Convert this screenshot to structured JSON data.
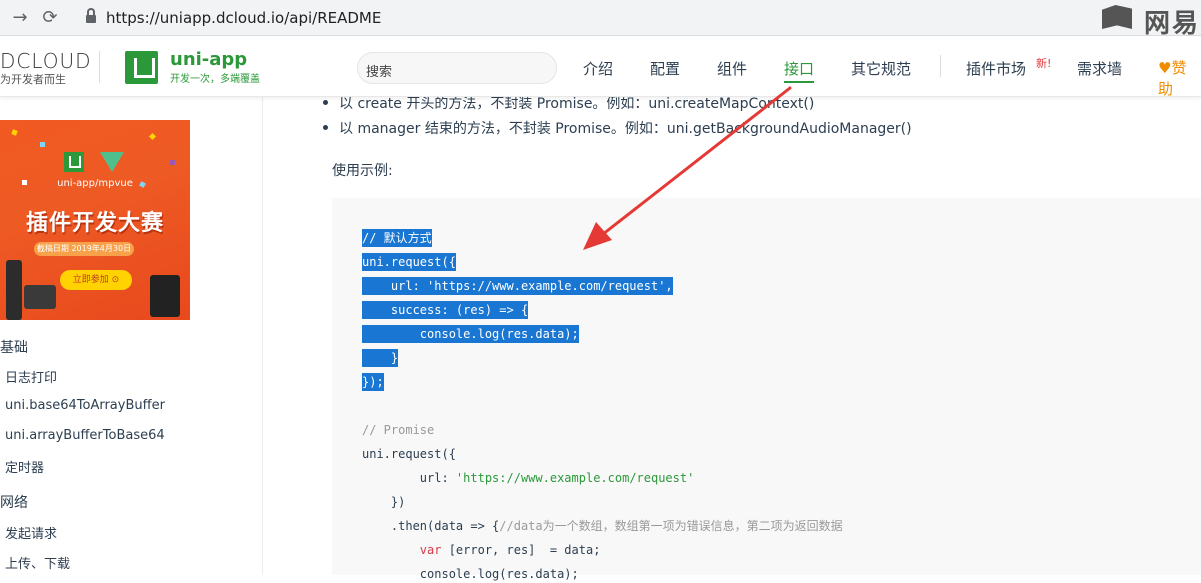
{
  "browser": {
    "url": "https://uniapp.dcloud.io/api/README",
    "watermark": "网易"
  },
  "header": {
    "dcloud_logo": "DCLOUD",
    "dcloud_slogan": "为开发者而生",
    "app_name": "uni-app",
    "app_tagline": "开发一次，多端覆盖",
    "search_placeholder": "搜索",
    "nav": [
      "介绍",
      "配置",
      "组件",
      "接口",
      "其它规范",
      "插件市场",
      "需求墙",
      "赞助"
    ],
    "active_nav": "接口",
    "new_badge": "新!"
  },
  "sidebar": {
    "banner": {
      "subtitle": "uni-app/mpvue",
      "title": "插件开发大赛",
      "deadline": "截稿日期 2019年4月30日",
      "button": "立即参加"
    },
    "groups": [
      {
        "label": "基础",
        "items": [
          "日志打印",
          "uni.base64ToArrayBuffer",
          "uni.arrayBufferToBase64",
          "定时器"
        ]
      },
      {
        "label": "网络",
        "items": [
          "发起请求",
          "上传、下载"
        ]
      }
    ]
  },
  "content": {
    "bullets": [
      "以 create 开头的方法，不封装 Promise。例如：uni.createMapContext()",
      "以 manager 结束的方法，不封装 Promise。例如：uni.getBackgroundAudioManager()"
    ],
    "usage_label": "使用示例:",
    "code": {
      "l1": "// 默认方式",
      "l2": "uni.request({",
      "l3": "    url: 'https://www.example.com/request',",
      "l4": "    success: (res) => {",
      "l5": "        console.log(res.data);",
      "l6": "    }",
      "l7": "});",
      "l8": "// Promise",
      "l9": "uni.request({",
      "l10a": "        url: ",
      "l10b": "'https://www.example.com/request'",
      "l11": "    })",
      "l12a": "    .then(data => {",
      "l12b": "//data为一个数组，数组第一项为错误信息，第二项为返回数据",
      "l13a": "var",
      "l13b": " [error, res]  = data;",
      "l14": "        console.log(res.data);"
    }
  },
  "colors": {
    "brand_green": "#2b9939",
    "selection_blue": "#1976d2",
    "annotation_red": "#e53935"
  }
}
